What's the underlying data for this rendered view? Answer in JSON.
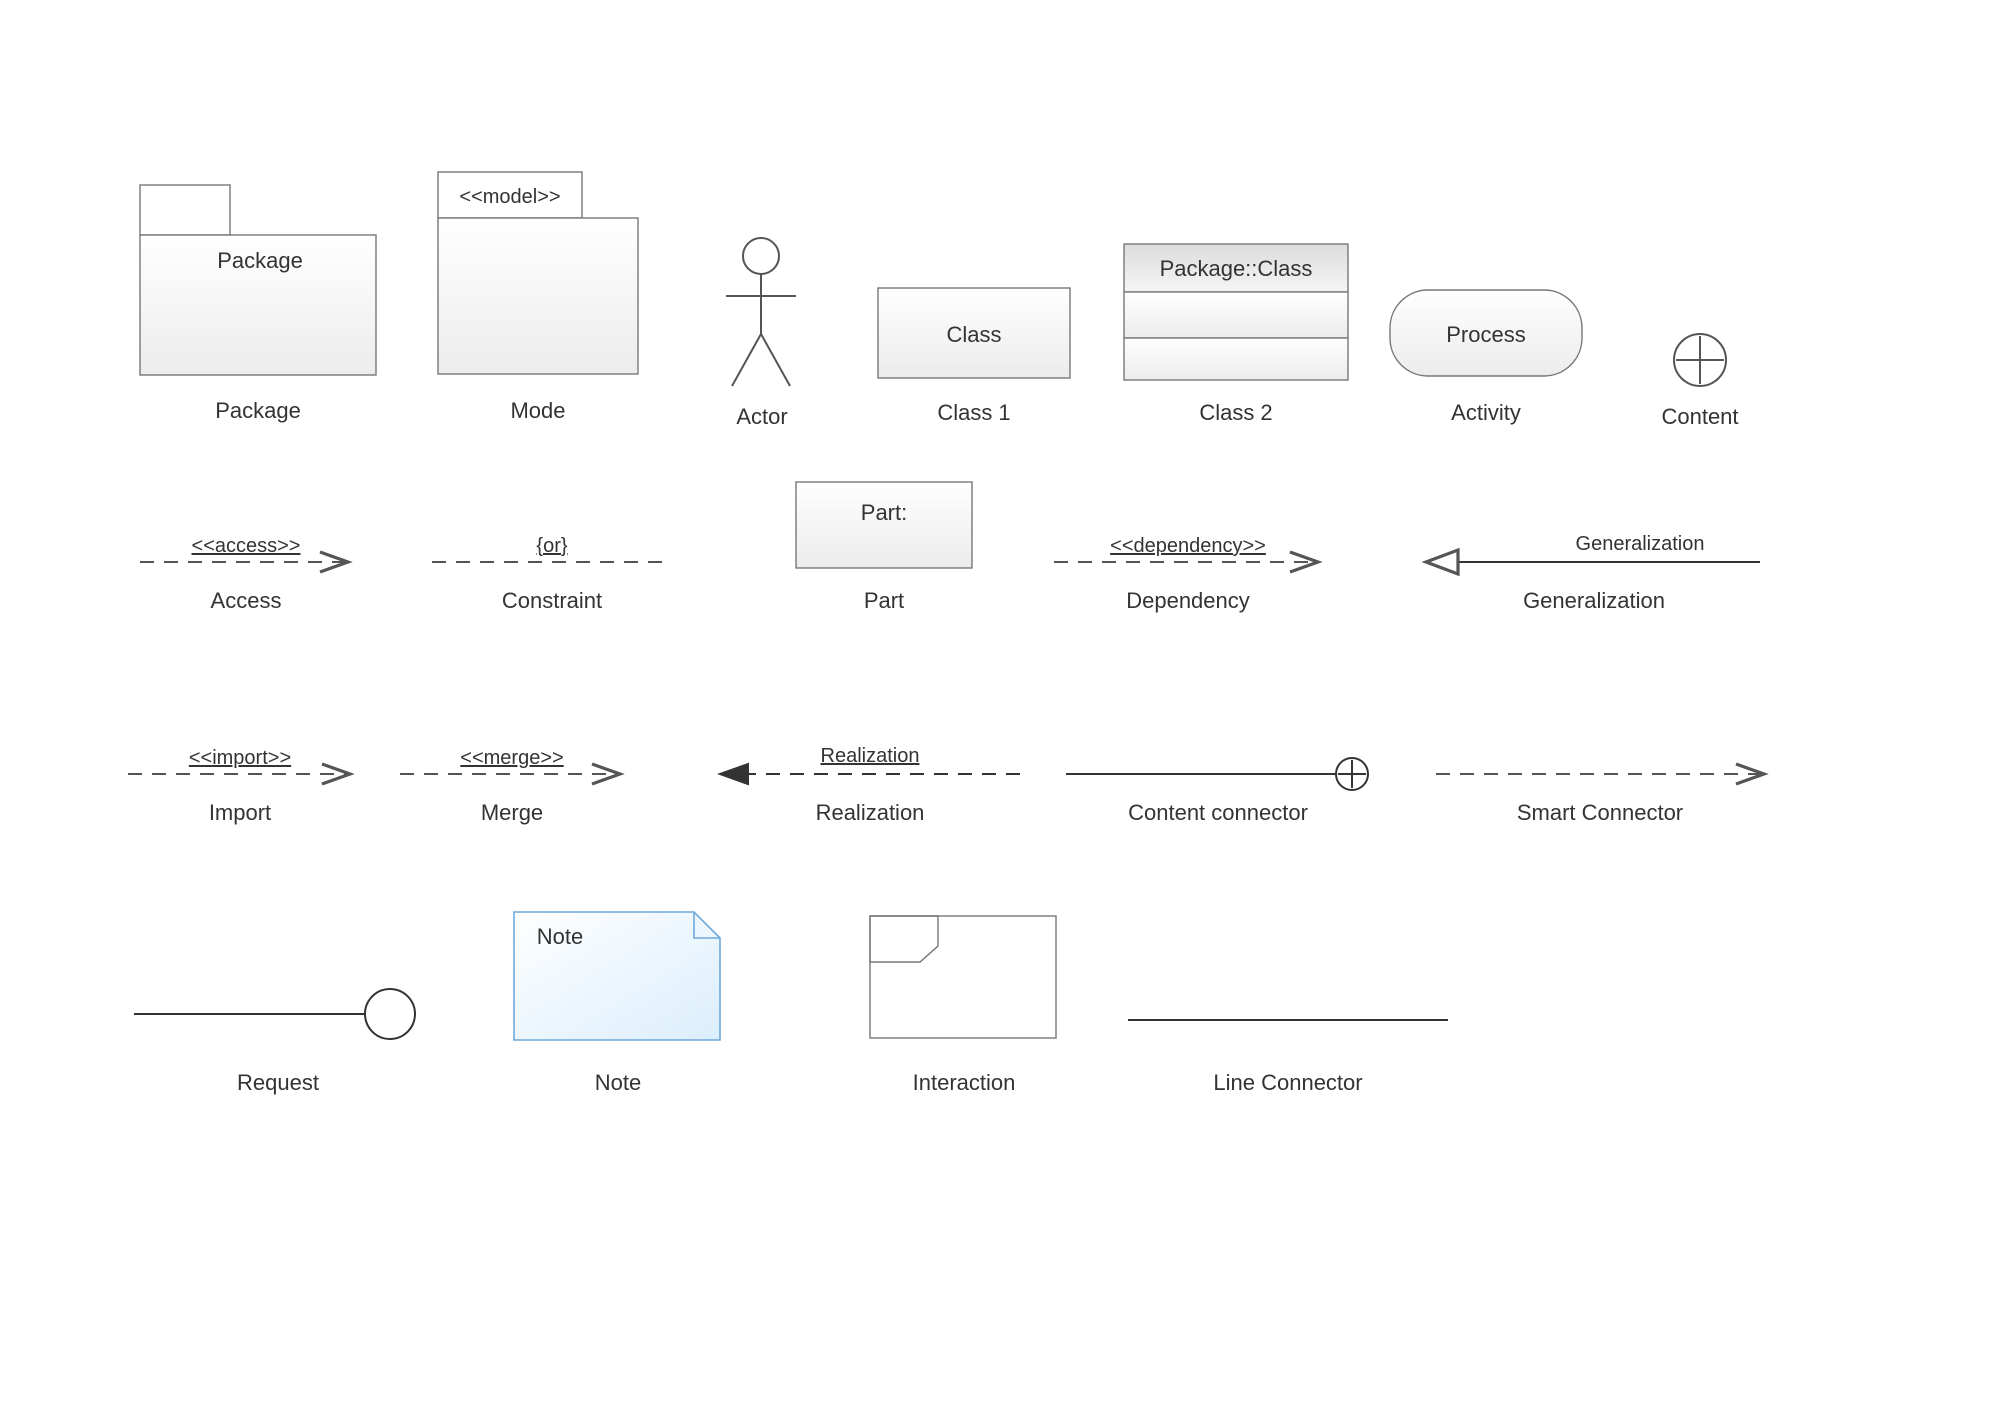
{
  "row1": {
    "package": {
      "inner": "Package",
      "label": "Package"
    },
    "mode": {
      "stereo": "<<model>>",
      "label": "Mode"
    },
    "actor": {
      "label": "Actor"
    },
    "class1": {
      "inner": "Class",
      "label": "Class 1"
    },
    "class2": {
      "inner": "Package::Class",
      "label": "Class 2"
    },
    "activity": {
      "inner": "Process",
      "label": "Activity"
    },
    "content": {
      "label": "Content"
    }
  },
  "row2": {
    "access": {
      "tag": "<<access>>",
      "label": "Access"
    },
    "constraint": {
      "tag": "{or}",
      "label": "Constraint"
    },
    "part": {
      "inner": "Part:",
      "label": "Part"
    },
    "dependency": {
      "tag": "<<dependency>>",
      "label": "Dependency"
    },
    "generalization": {
      "tag": "Generalization",
      "label": "Generalization"
    }
  },
  "row3": {
    "import": {
      "tag": "<<import>>",
      "label": "Import"
    },
    "merge": {
      "tag": "<<merge>>",
      "label": "Merge"
    },
    "realization": {
      "tag": "Realization",
      "label": "Realization"
    },
    "contentconn": {
      "label": "Content connector"
    },
    "smart": {
      "label": "Smart Connector"
    }
  },
  "row4": {
    "request": {
      "label": "Request"
    },
    "note": {
      "inner": "Note",
      "label": "Note"
    },
    "interaction": {
      "label": "Interaction"
    },
    "lineconn": {
      "label": "Line Connector"
    }
  }
}
